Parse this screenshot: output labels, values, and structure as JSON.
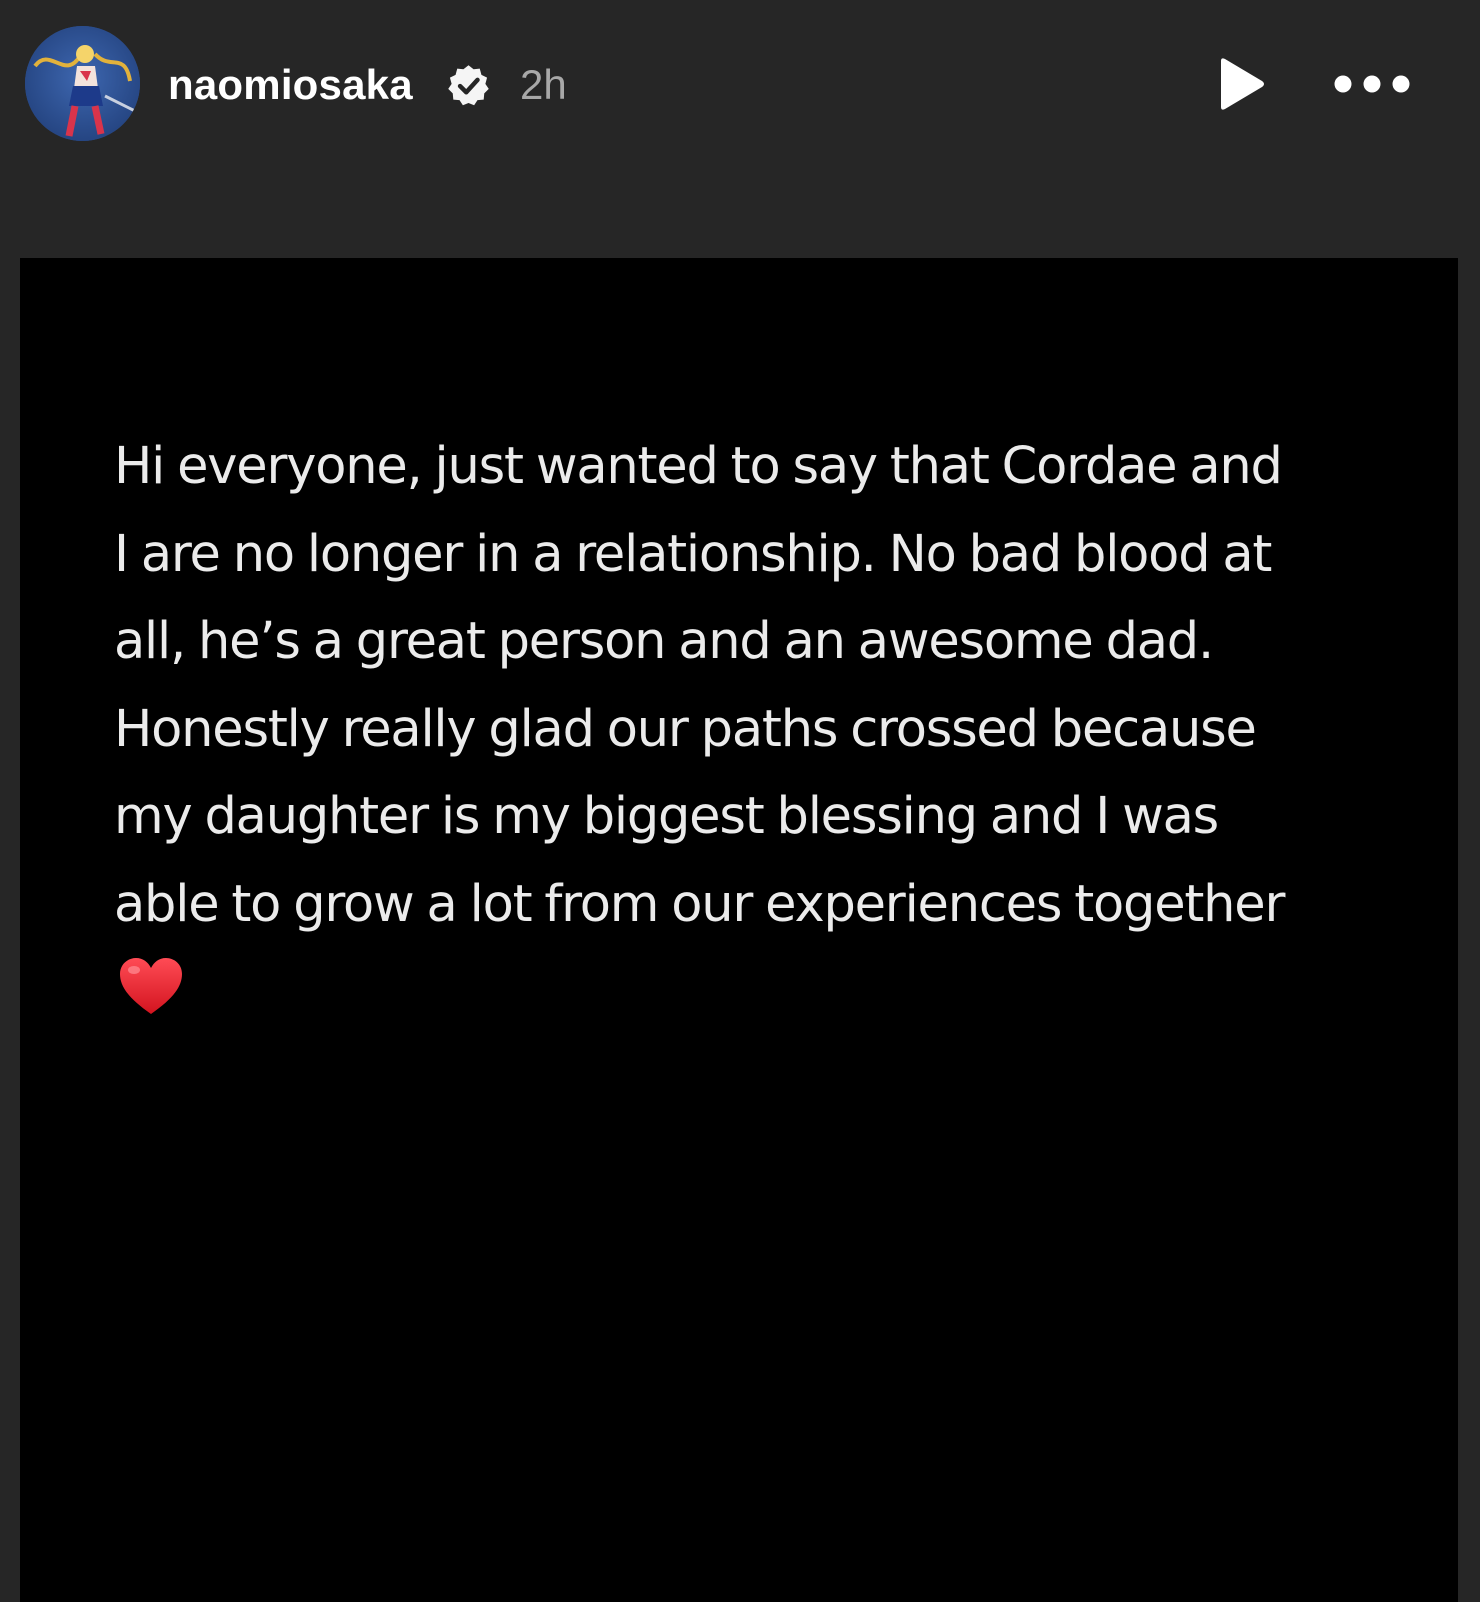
{
  "header": {
    "username": "naomiosaka",
    "time": "2h",
    "verified_icon": "verified-badge-icon",
    "play_icon": "play-icon",
    "more_icon": "more-horizontal-icon"
  },
  "story": {
    "lines": [
      "Hi everyone, just wanted to say that Cordae and",
      "I are no longer in a relationship. No bad blood at",
      "all, he’s a great person and an awesome dad.",
      "Honestly really glad our paths crossed because",
      "my daughter is my biggest blessing and I was",
      "able to grow a lot from our experiences together"
    ],
    "emoji": "❤️"
  },
  "colors": {
    "background": "#262626",
    "story_background": "#000000",
    "text": "#ebebeb",
    "heart": "#e8232f"
  }
}
